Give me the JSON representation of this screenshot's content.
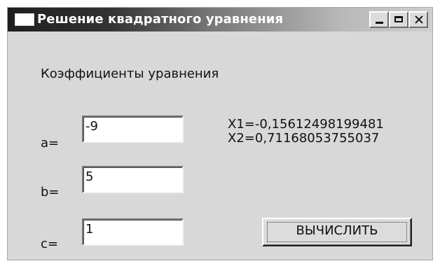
{
  "window": {
    "title": "Решение квадратного уравнения"
  },
  "labels": {
    "coefficients": "Коэффициенты уравнения",
    "a": "a=",
    "b": "b=",
    "c": "c="
  },
  "inputs": {
    "a": "-9",
    "b": "5",
    "c": "1"
  },
  "results": {
    "x1": "X1=-0,15612498199481",
    "x2": "X2=0,71168053755037"
  },
  "buttons": {
    "calculate": "ВЫЧИСЛИТЬ"
  },
  "icons": {
    "app": "app-window-icon",
    "minimize": "minimize-icon",
    "maximize": "maximize-icon",
    "close": "close-icon"
  },
  "colors": {
    "window_background": "#d8d8d8",
    "title_text": "#ffffff",
    "title_dark": "#1e1e1e",
    "title_light": "#d0d0d0"
  }
}
